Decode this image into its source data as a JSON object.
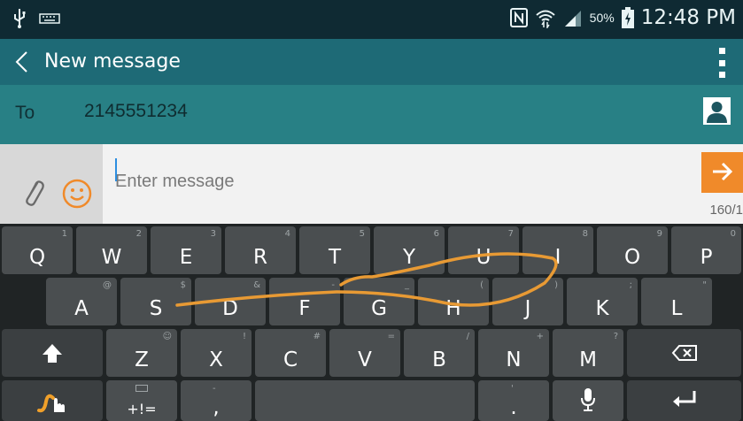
{
  "status_bar": {
    "battery_percent": "50%",
    "time": "12:48 PM",
    "icons": [
      "usb-icon",
      "keyboard-icon",
      "nfc-icon",
      "wifi-icon",
      "signal-icon",
      "battery-icon"
    ]
  },
  "app_bar": {
    "title": "New message"
  },
  "recipient": {
    "label": "To",
    "value": "2145551234"
  },
  "compose": {
    "placeholder": "Enter message",
    "char_counter": "160/1",
    "colors": {
      "send_button": "#f08a2a",
      "emoji_icon": "#f08a2a",
      "caret": "#2d8ee0"
    }
  },
  "keyboard": {
    "row1": [
      {
        "label": "Q",
        "hint": "1"
      },
      {
        "label": "W",
        "hint": "2"
      },
      {
        "label": "E",
        "hint": "3"
      },
      {
        "label": "R",
        "hint": "4"
      },
      {
        "label": "T",
        "hint": "5"
      },
      {
        "label": "Y",
        "hint": "6"
      },
      {
        "label": "U",
        "hint": "7"
      },
      {
        "label": "I",
        "hint": "8"
      },
      {
        "label": "O",
        "hint": "9"
      },
      {
        "label": "P",
        "hint": "0"
      }
    ],
    "row2": [
      {
        "label": "A",
        "hint": "@"
      },
      {
        "label": "S",
        "hint": "$"
      },
      {
        "label": "D",
        "hint": "&"
      },
      {
        "label": "F",
        "hint": "-"
      },
      {
        "label": "G",
        "hint": "_"
      },
      {
        "label": "H",
        "hint": "("
      },
      {
        "label": "J",
        "hint": ")"
      },
      {
        "label": "K",
        "hint": ";"
      },
      {
        "label": "L",
        "hint": "\""
      }
    ],
    "row3": [
      {
        "label": "Z",
        "hint": "☺"
      },
      {
        "label": "X",
        "hint": "!"
      },
      {
        "label": "C",
        "hint": "#"
      },
      {
        "label": "V",
        "hint": "="
      },
      {
        "label": "B",
        "hint": "/"
      },
      {
        "label": "N",
        "hint": "+"
      },
      {
        "label": "M",
        "hint": "?"
      }
    ],
    "symbols_label": "+!=",
    "comma_label": ",",
    "period_label": ".",
    "period_hint": "'",
    "swipe_color": "#e89a34"
  }
}
